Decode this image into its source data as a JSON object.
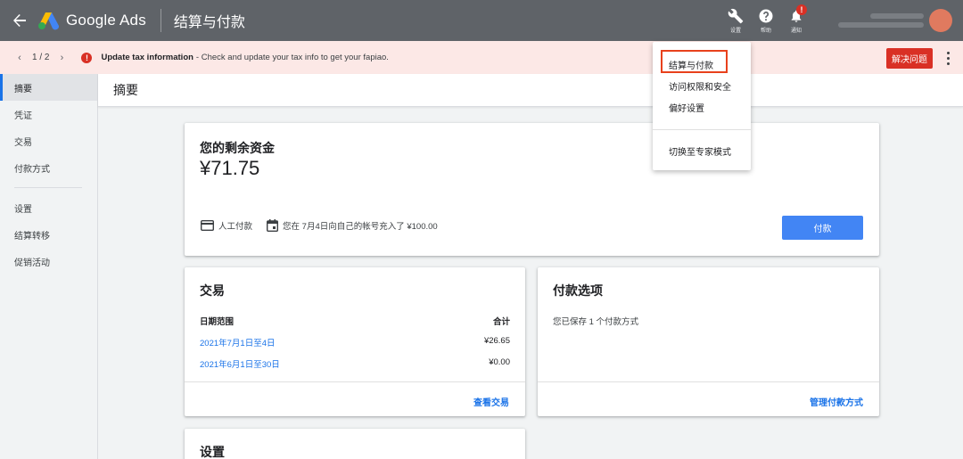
{
  "topbar": {
    "brand": "Google Ads",
    "page_title": "结算与付款",
    "tools": [
      {
        "label": "设置",
        "icon": "wrench-icon"
      },
      {
        "label": "帮助",
        "icon": "help-icon"
      },
      {
        "label": "通知",
        "icon": "bell-icon",
        "badge": "!"
      }
    ]
  },
  "notification": {
    "pager": "1 / 2",
    "title": "Update tax information",
    "message": "- Check and update your tax info to get your fapiao.",
    "action": "解决问题"
  },
  "sidebar": {
    "items": [
      {
        "label": "摘要",
        "active": true
      },
      {
        "label": "凭证"
      },
      {
        "label": "交易"
      },
      {
        "label": "付款方式"
      }
    ],
    "items2": [
      {
        "label": "设置"
      },
      {
        "label": "结算转移"
      },
      {
        "label": "促销活动"
      }
    ]
  },
  "header": {
    "title": "摘要"
  },
  "balance": {
    "label": "您的剩余资金",
    "amount": "¥71.75",
    "payment_type": "人工付款",
    "last_payment": "您在 7月4日向自己的帐号充入了 ¥100.00",
    "pay_button": "付款"
  },
  "transactions": {
    "title": "交易",
    "col_range": "日期范围",
    "col_total": "合计",
    "rows": [
      {
        "range": "2021年7月1日至4日",
        "amount": "¥26.65"
      },
      {
        "range": "2021年6月1日至30日",
        "amount": "¥0.00"
      }
    ],
    "link": "查看交易"
  },
  "payment_options": {
    "title": "付款选项",
    "text": "您已保存 1 个付款方式",
    "link": "管理付款方式"
  },
  "settings_card": {
    "title": "设置"
  },
  "menu": {
    "items": [
      "结算与付款",
      "访问权限和安全",
      "偏好设置"
    ],
    "expert": "切换至专家模式"
  },
  "colors": {
    "topbar": "#5f6368",
    "alert": "#d93025",
    "accent": "#1a73e8",
    "button": "#4285f4",
    "highlight": "#e8411c"
  }
}
